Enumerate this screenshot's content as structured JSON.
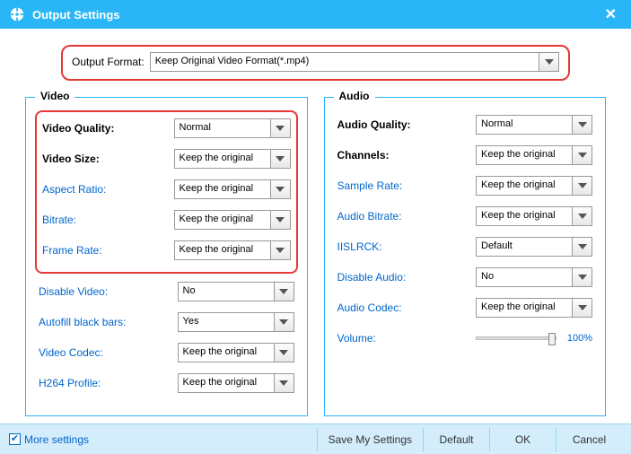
{
  "title": "Output Settings",
  "format": {
    "label": "Output Format:",
    "value": "Keep Original Video Format(*.mp4)"
  },
  "video": {
    "legend": "Video",
    "quality_label": "Video Quality:",
    "quality_value": "Normal",
    "size_label": "Video Size:",
    "size_value": "Keep the original",
    "aspect_label": "Aspect Ratio:",
    "aspect_value": "Keep the original",
    "bitrate_label": "Bitrate:",
    "bitrate_value": "Keep the original",
    "framerate_label": "Frame Rate:",
    "framerate_value": "Keep the original",
    "disable_label": "Disable Video:",
    "disable_value": "No",
    "autofill_label": "Autofill black bars:",
    "autofill_value": "Yes",
    "codec_label": "Video Codec:",
    "codec_value": "Keep the original",
    "h264_label": "H264 Profile:",
    "h264_value": "Keep the original"
  },
  "audio": {
    "legend": "Audio",
    "quality_label": "Audio Quality:",
    "quality_value": "Normal",
    "channels_label": "Channels:",
    "channels_value": "Keep the original",
    "samplerate_label": "Sample Rate:",
    "samplerate_value": "Keep the original",
    "bitrate_label": "Audio Bitrate:",
    "bitrate_value": "Keep the original",
    "iislrck_label": "IISLRCK:",
    "iislrck_value": "Default",
    "disable_label": "Disable Audio:",
    "disable_value": "No",
    "codec_label": "Audio Codec:",
    "codec_value": "Keep the original",
    "volume_label": "Volume:",
    "volume_value": "100%"
  },
  "footer": {
    "more": "More settings",
    "save": "Save My Settings",
    "default": "Default",
    "ok": "OK",
    "cancel": "Cancel"
  }
}
